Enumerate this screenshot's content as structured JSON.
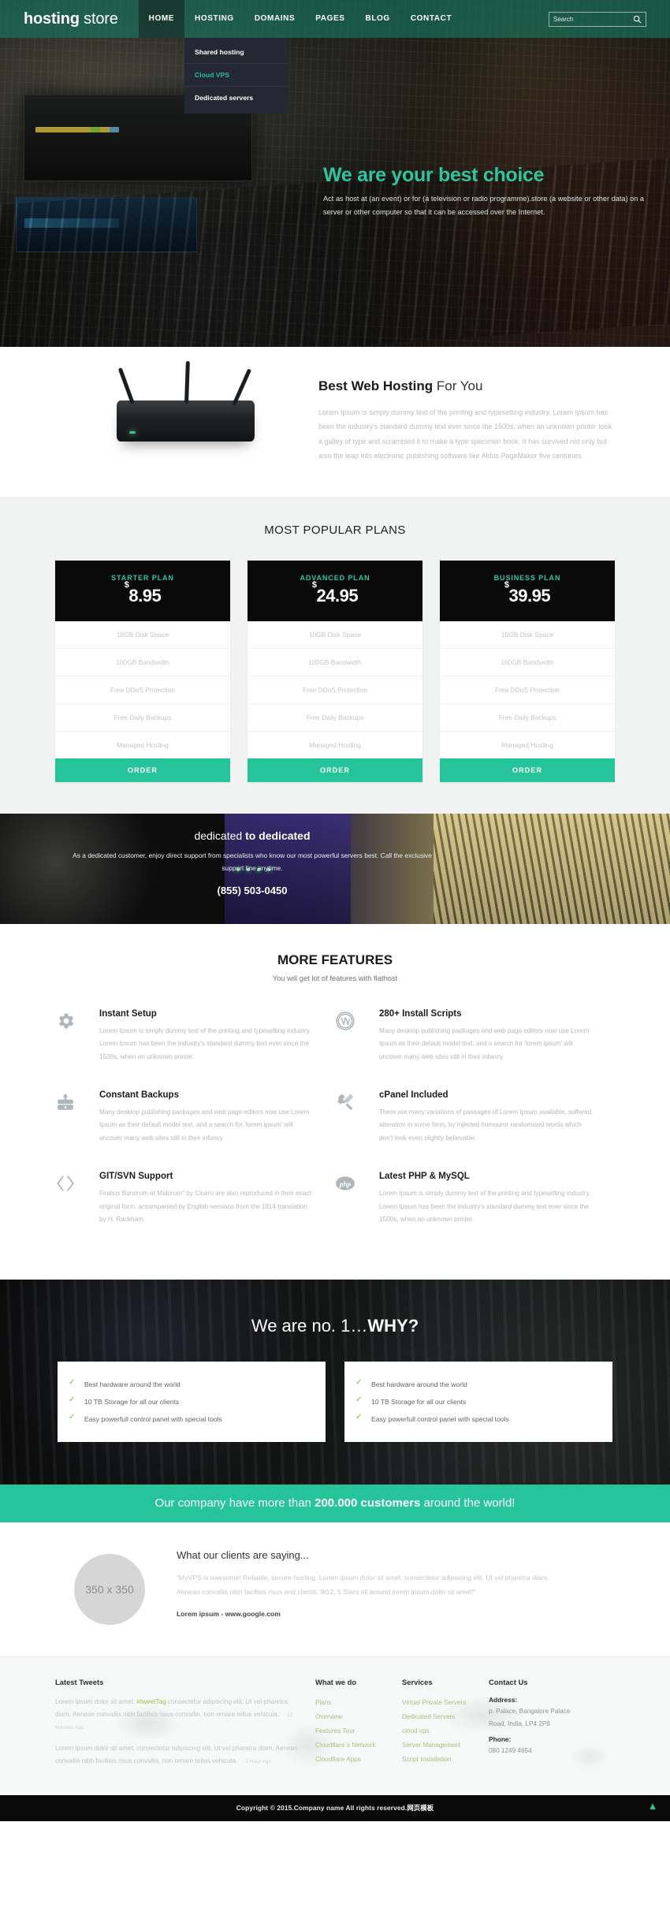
{
  "header": {
    "logo_bold": "hosting",
    "logo_light": " store",
    "nav": [
      {
        "label": "HOME",
        "active": true
      },
      {
        "label": "HOSTING",
        "active": false
      },
      {
        "label": "DOMAINS",
        "active": false
      },
      {
        "label": "PAGES",
        "active": false
      },
      {
        "label": "BLOG",
        "active": false
      },
      {
        "label": "CONTACT",
        "active": false
      }
    ],
    "dropdown": [
      {
        "label": "Shared hosting",
        "highlight": false
      },
      {
        "label": "Cloud VPS",
        "highlight": true
      },
      {
        "label": "Dedicated servers",
        "highlight": false
      }
    ],
    "search": {
      "placeholder": "Search",
      "value": "",
      "icon": "search-icon"
    }
  },
  "hero": {
    "title": "We are your best choice",
    "text": "Act as host at (an event) or for (a television or radio programme).store (a website or other data) on a server or other computer so that it can be accessed over the Internet."
  },
  "best_hosting": {
    "title_bold": "Best Web Hosting",
    "title_thin": " For You",
    "body": "Lorem Ipsum is simply dummy text of the printing and typesetting industry. Lorem Ipsum has been the industry's standard dummy text ever since the 1500s, when an unknown printer took a galley of type and scrambled it to make a type specimen book. It has survived not only but also the leap into electronic publishing software like Aldus PageMaker five centuries."
  },
  "plans": {
    "heading": "MOST POPULAR PLANS",
    "order_label": "ORDER",
    "currency": "$",
    "items": [
      {
        "name": "STARTER PLAN",
        "price": "8.95",
        "features": [
          "10GB Disk Space",
          "100GB Bandwidth",
          "Free DDoS Protection",
          "Free Daily Backups",
          "Managed Hosting"
        ]
      },
      {
        "name": "ADVANCED PLAN",
        "price": "24.95",
        "features": [
          "10GB Disk Space",
          "100GB Bandwidth",
          "Free DDoS Protection",
          "Free Daily Backups",
          "Managed Hosting"
        ]
      },
      {
        "name": "BUSINESS PLAN",
        "price": "39.95",
        "features": [
          "10GB Disk Space",
          "100GB Bandwidth",
          "Free DDoS Protection",
          "Free Daily Backups",
          "Managed Hosting"
        ]
      }
    ]
  },
  "dedicated": {
    "title_thin": "dedicated ",
    "title_bold": "to dedicated",
    "text": "As a dedicated customer, enjoy direct support from specialists who know our most powerful servers best. Call the exclusive support line anytime.",
    "phone": "(855) 503-0450"
  },
  "features": {
    "heading": "MORE FEATURES",
    "subheading": "You will get lot of features with flathost",
    "items": [
      {
        "icon": "gear-icon",
        "title": "Instant Setup",
        "text": "Lorem Ipsum is simply dummy text of the printing and typesetting industry. Lorem Ipsum has been the industry's standard dummy text ever since the 1500s, when an unknown printer."
      },
      {
        "icon": "wordpress-icon",
        "title": "280+ Install Scripts",
        "text": "Many desktop publishing packages and web page editors now use Lorem Ipsum as their default model text, and a search for 'lorem ipsum' will uncover many web sites still in their infancy"
      },
      {
        "icon": "backup-box-icon",
        "title": "Constant Backups",
        "text": "Many desktop publishing packages and web page editors now use Lorem Ipsum as their default model text, and a search for 'lorem ipsum' will uncover many web sites still in their infancy"
      },
      {
        "icon": "wrench-screwdriver-icon",
        "title": "cPanel Included",
        "text": "There are many variations of passages of Lorem Ipsum available, suffered alteration in some form, by injected humouror randomised words which don't look even slightly believable."
      },
      {
        "icon": "code-brackets-icon",
        "title": "GIT/SVN Support",
        "text": "Finibus Bonorum et Malorum\" by Cicero are also reproduced in their exact original form, accompanied by English versions from the 1914 translation by H. Rackham"
      },
      {
        "icon": "php-icon",
        "title": "Latest PHP & MySQL",
        "text": "Lorem Ipsum is simply dummy text of the printing and typesetting industry. Lorem Ipsum has been the industry's standard dummy text ever since the 1500s, when an unknown printer."
      }
    ]
  },
  "why": {
    "title_thin": "We are no. 1…",
    "title_bold": "WHY?",
    "check_icon": "check-icon",
    "cards": [
      {
        "items": [
          "Best hardware around the world",
          "10 TB Storage for all our clients",
          "Easy powerfull control panel with special tools"
        ]
      },
      {
        "items": [
          "Best hardware around the world",
          "10 TB Storage for all our clients",
          "Easy powerfull control panel with special tools"
        ]
      }
    ]
  },
  "customers_bar": {
    "pre": "Our company have more than ",
    "bold": "200.000 customers",
    "post": " around the world!"
  },
  "testimonial": {
    "avatar_label": "350 x 350",
    "heading": "What our clients are saying...",
    "quote": "\"MyVPS is awesome! Reliable, secure hosting, Lorem ipsum dolor sit amet, consectetur adipiscing elit. Ut vel pharetra diam. Aenean convallis nibh facilisis risus and clients. 9/12, 5 Stars all around lorem ipsum dolto sit amet!\"",
    "source": "Lorem ipsum - www.google.com"
  },
  "footer": {
    "tweets": {
      "heading": "Latest Tweets",
      "items": [
        {
          "pre": "Lorem ipsum dolor sit amet, ",
          "tag": "#tweetTag",
          "post": " consectetur adipiscing elit. Ut vel pharetra diam. Aenean convallis nibh facilisis risus convallin, non ornare tellus vehicula.",
          "ago": "10 Minutes Ago"
        },
        {
          "pre": "Lorem ipsum dolor sit amet, consectetur adipiscing elit. Ut vel pharetra diam. Aenean convallis nibh facilisis risus convallis, non ornare tellus vehicula.",
          "tag": "",
          "post": "",
          "ago": "1 Hour Ago"
        }
      ]
    },
    "what_we_do": {
      "heading": "What we do",
      "links": [
        "Plans",
        "Overview",
        "Features Tour",
        "Cloudflare`s Network",
        "Cloudflare Apps"
      ]
    },
    "services": {
      "heading": "Services",
      "links": [
        "Virtual Private Servers",
        "Dedicated Servers",
        "cloud vps",
        "Server Management",
        "Script Installation"
      ]
    },
    "contact": {
      "heading": "Contact Us",
      "address_label": "Address:",
      "address_line1": "p. Palace, Bangalore Palace",
      "address_line2": "Road, India, LP4 2P8",
      "phone_label": "Phone:",
      "phone_value": "080 1249 4654"
    },
    "copyright": "Copyright © 2015.Company name All rights reserved.",
    "copyright_cn": "网页模板",
    "to_top_icon": "chevron-up-icon"
  },
  "colors": {
    "accent": "#25c49a",
    "hero_title": "#2ec6a0",
    "dark": "#0a0a0a"
  }
}
